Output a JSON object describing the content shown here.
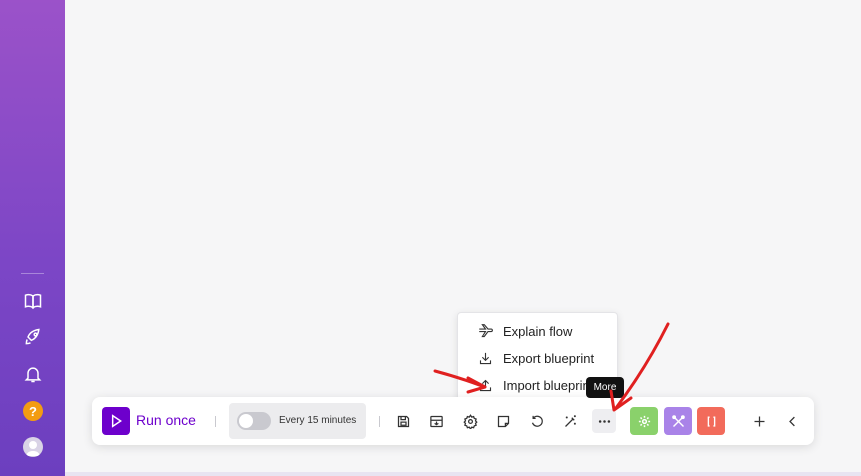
{
  "sidebar": {
    "items": [
      {
        "icon": "book-icon"
      },
      {
        "icon": "rocket-icon"
      },
      {
        "icon": "bell-icon"
      },
      {
        "icon": "help-icon",
        "badge": "?"
      },
      {
        "icon": "avatar-icon"
      }
    ]
  },
  "toolbar": {
    "run_label": "Run once",
    "schedule_label": "Every 15 minutes",
    "schedule_enabled": false,
    "icons": [
      "save-icon",
      "scenario-io-icon",
      "settings-icon",
      "notes-icon",
      "undo-icon",
      "magic-wand-icon",
      "more-icon"
    ],
    "colored_buttons": [
      {
        "icon": "gear-badge-icon",
        "color": "#8ad16b"
      },
      {
        "icon": "tools-icon",
        "color": "#a983e8"
      },
      {
        "icon": "json-icon",
        "color": "#f26b5b"
      }
    ],
    "add_icon": "plus-icon",
    "collapse_icon": "chevron-left-icon"
  },
  "more_menu": {
    "items": [
      {
        "label": "Explain flow",
        "icon": "plane-icon"
      },
      {
        "label": "Export blueprint",
        "icon": "download-icon"
      },
      {
        "label": "Import blueprint",
        "icon": "upload-icon"
      }
    ]
  },
  "tooltip": {
    "text": "More"
  },
  "colors": {
    "accent": "#6d00cc",
    "annotation": "#e02020"
  }
}
